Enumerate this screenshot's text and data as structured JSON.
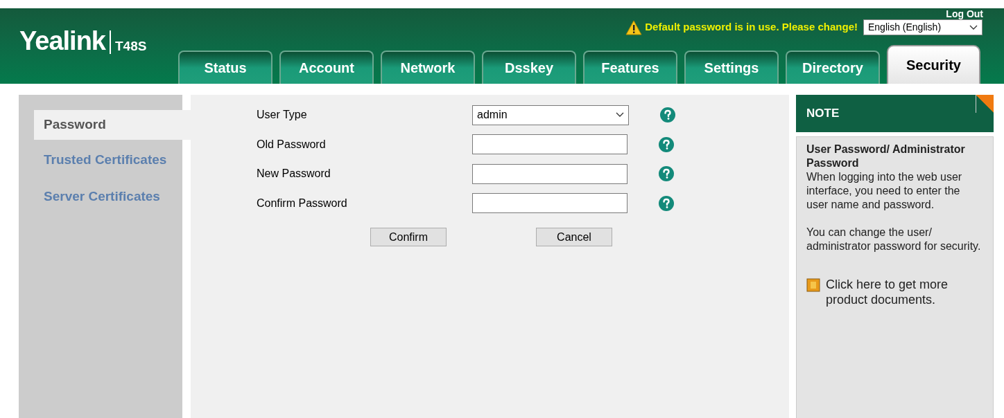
{
  "header": {
    "logo": "Yealink",
    "model": "T48S",
    "logout": "Log Out",
    "warning": "Default password is in use. Please change!",
    "language": "English (English)"
  },
  "tabs": [
    {
      "label": "Status",
      "selected": false
    },
    {
      "label": "Account",
      "selected": false
    },
    {
      "label": "Network",
      "selected": false
    },
    {
      "label": "Dsskey",
      "selected": false
    },
    {
      "label": "Features",
      "selected": false
    },
    {
      "label": "Settings",
      "selected": false
    },
    {
      "label": "Directory",
      "selected": false
    },
    {
      "label": "Security",
      "selected": true
    }
  ],
  "sidebar": {
    "items": [
      {
        "label": "Password",
        "selected": true
      },
      {
        "label": "Trusted Certificates",
        "selected": false
      },
      {
        "label": "Server Certificates",
        "selected": false
      }
    ]
  },
  "form": {
    "fields": [
      {
        "label": "User Type",
        "kind": "select",
        "value": "admin"
      },
      {
        "label": "Old Password",
        "kind": "password"
      },
      {
        "label": "New Password",
        "kind": "password"
      },
      {
        "label": "Confirm Password",
        "kind": "password"
      }
    ],
    "buttons": [
      "Confirm",
      "Cancel"
    ]
  },
  "note": {
    "title": "NOTE",
    "heading": "User Password/ Administrator Password",
    "paragraphs": [
      "When logging into the web user interface, you need to enter the user name and password.",
      "You can change the user/ administrator password for security."
    ],
    "link": "Click here to get more product documents."
  }
}
